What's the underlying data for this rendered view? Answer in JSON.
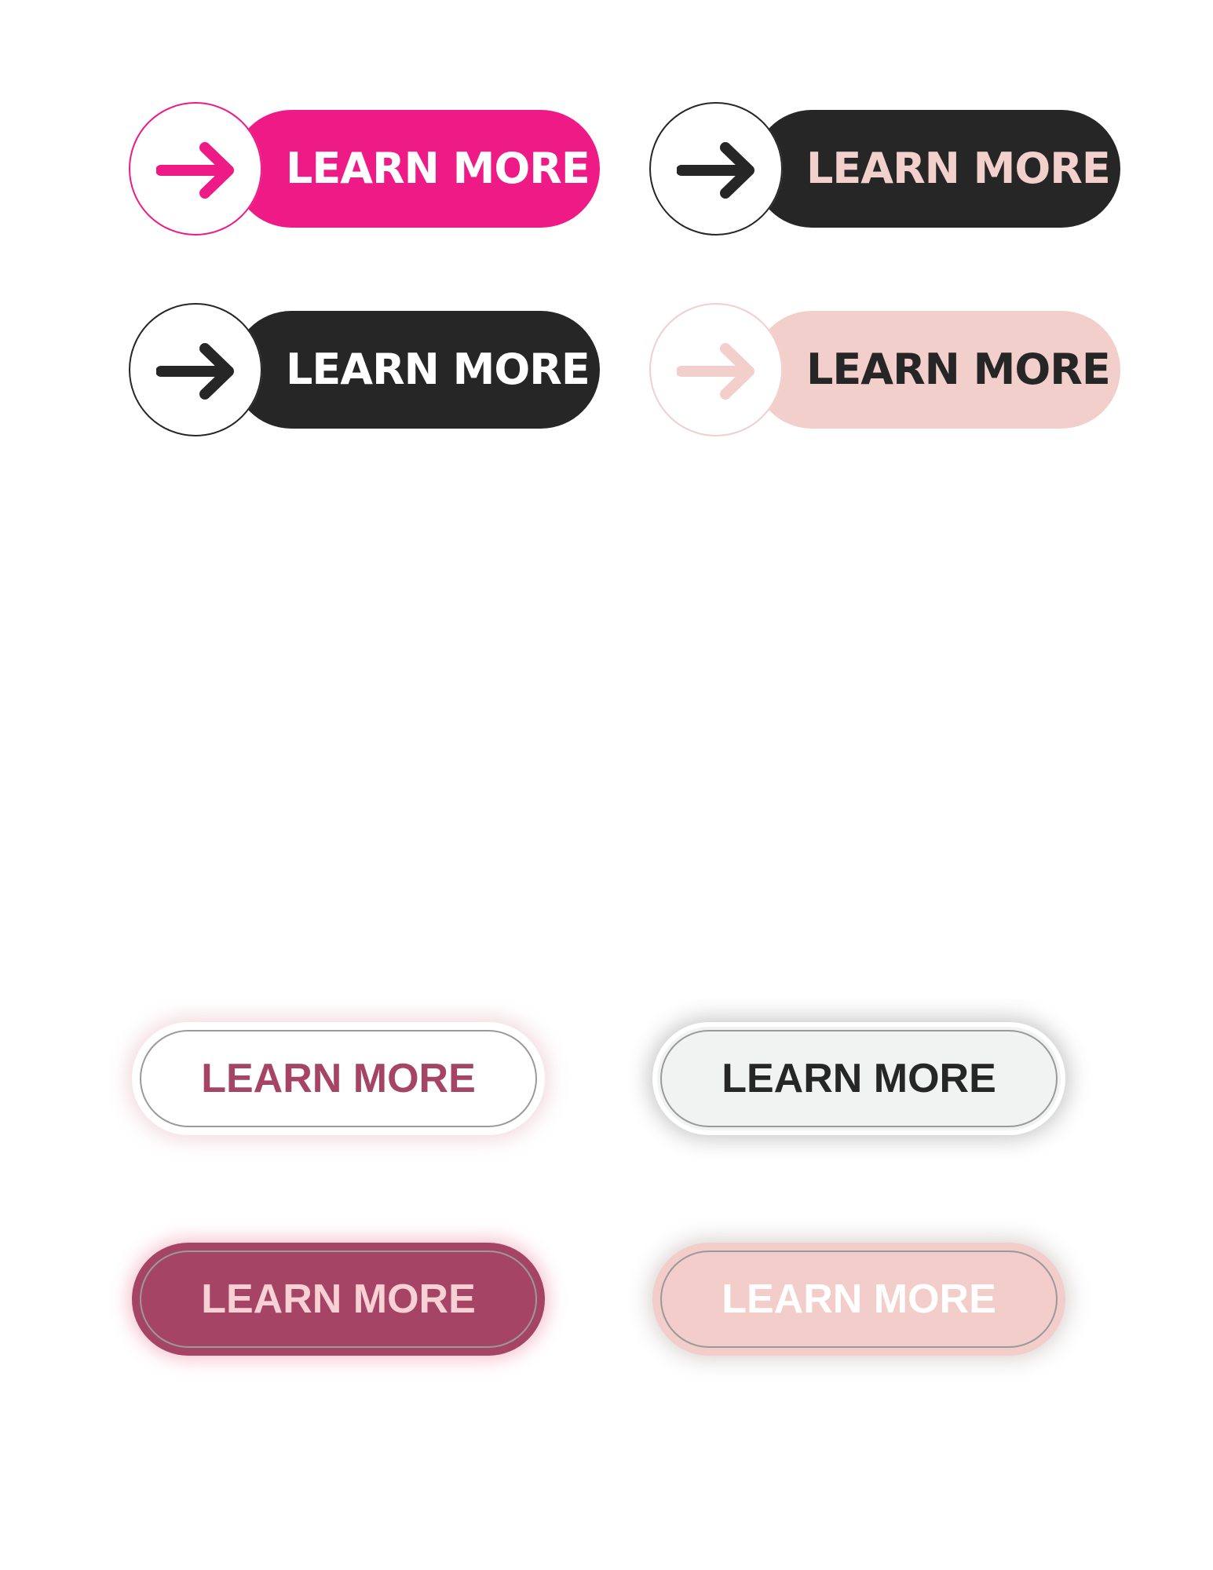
{
  "colors": {
    "hot_pink": "#ee1a85",
    "charcoal": "#262626",
    "blush": "#f2cfcb",
    "rose": "#a64466",
    "light_gray": "#f1f3f2",
    "white": "#ffffff"
  },
  "arrow_buttons": [
    {
      "label": "LEARN MORE",
      "icon": "arrow-right-icon",
      "pill_color": "#ee1a85",
      "icon_color": "#ee1a85",
      "text_color": "#ffffff"
    },
    {
      "label": "LEARN MORE",
      "icon": "arrow-right-icon",
      "pill_color": "#262626",
      "icon_color": "#262626",
      "text_color": "#f2d0cc"
    },
    {
      "label": "LEARN MORE",
      "icon": "arrow-right-icon",
      "pill_color": "#262626",
      "icon_color": "#262626",
      "text_color": "#ffffff"
    },
    {
      "label": "LEARN MORE",
      "icon": "arrow-right-icon",
      "pill_color": "#f2cfcb",
      "icon_color": "#f2cfcb",
      "text_color": "#262626"
    }
  ],
  "soft_buttons": [
    {
      "label": "LEARN MORE",
      "fill_color": "#ffffff",
      "text_color": "#a64466"
    },
    {
      "label": "LEARN MORE",
      "fill_color": "#f1f3f2",
      "text_color": "#262626"
    },
    {
      "label": "LEARN MORE",
      "fill_color": "#a64466",
      "text_color": "#f7d1d6"
    },
    {
      "label": "LEARN MORE",
      "fill_color": "#f2cdca",
      "text_color": "#ffffff"
    }
  ]
}
